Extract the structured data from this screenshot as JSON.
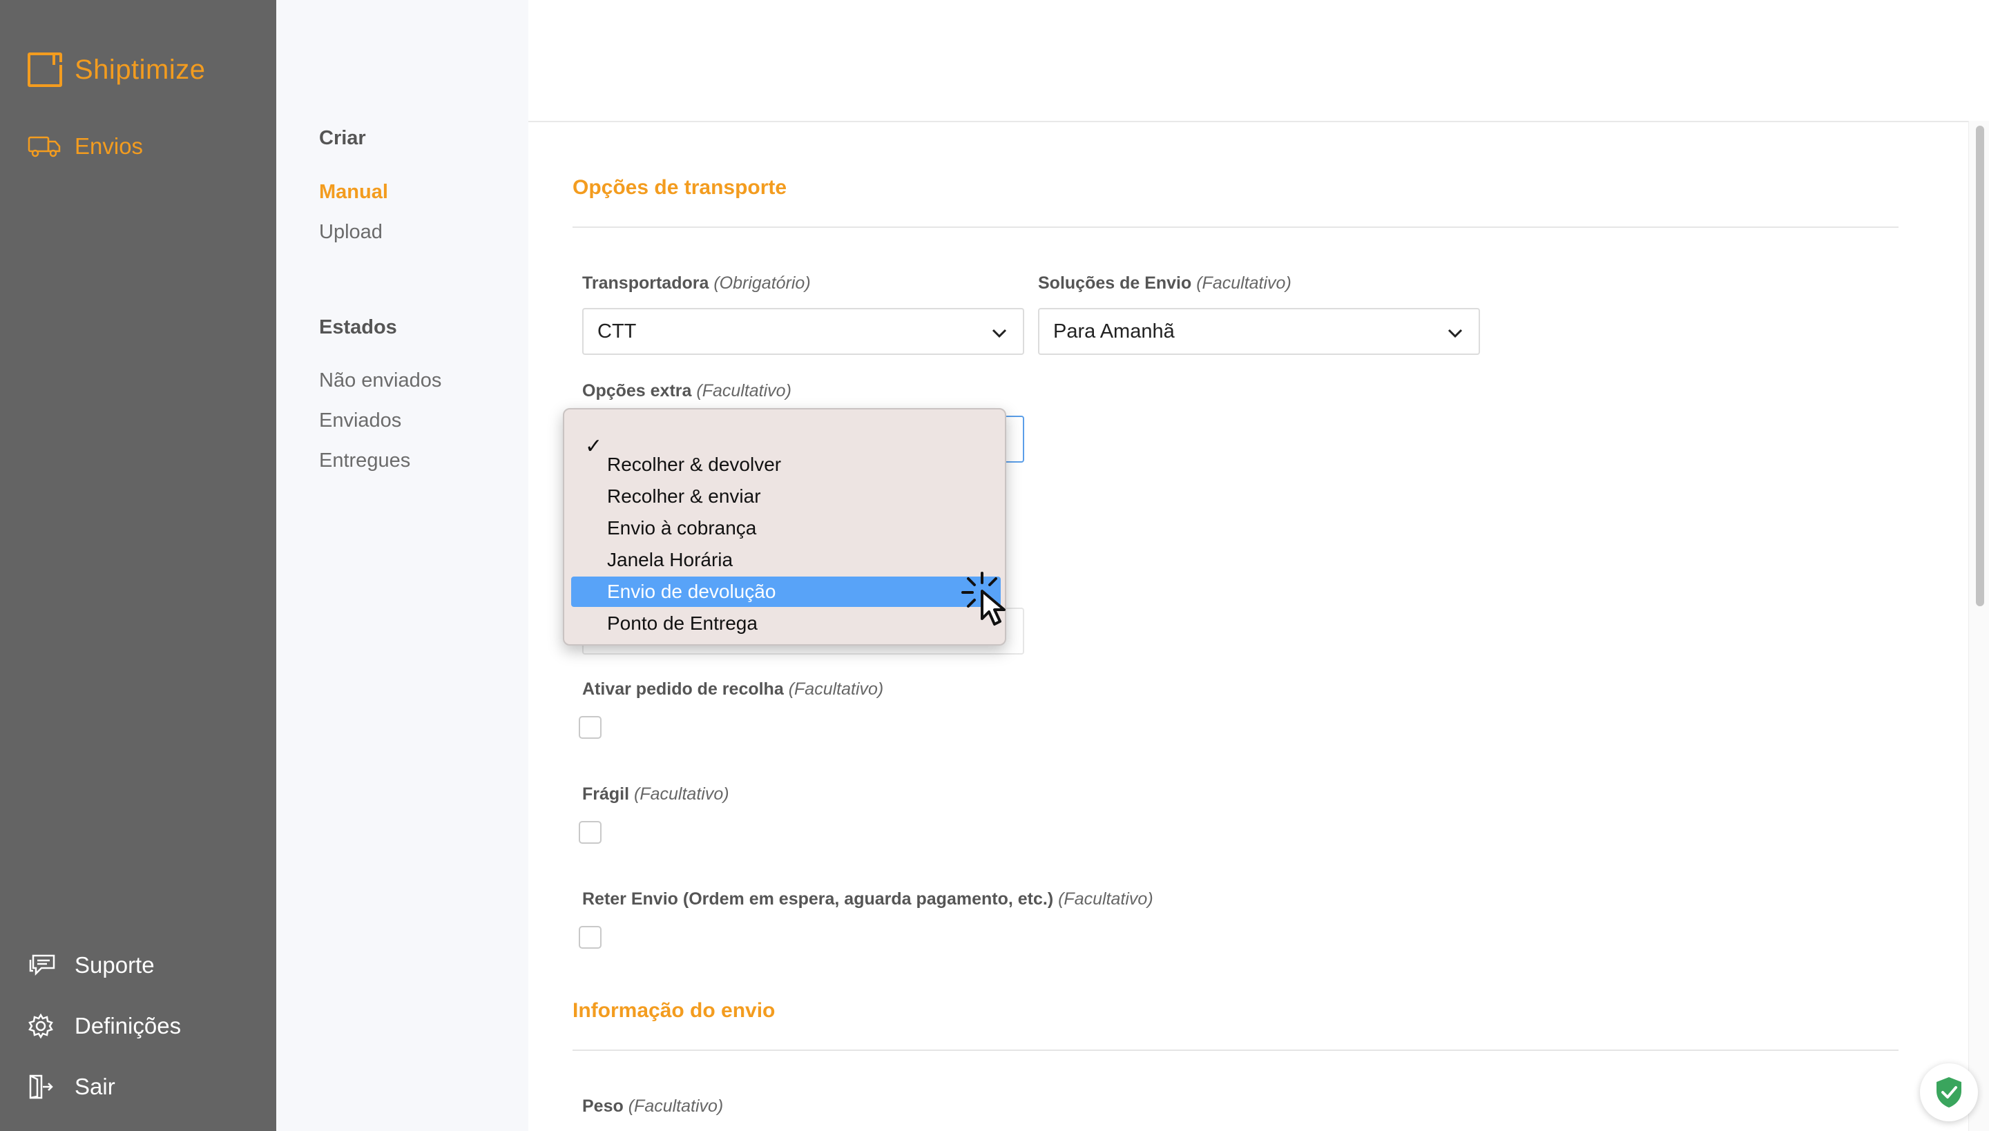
{
  "brand": {
    "name": "Shiptimize",
    "color": "#f39c1f"
  },
  "sidebar": {
    "items": [
      {
        "label": "Envios",
        "icon": "truck-icon",
        "active": true
      },
      {
        "label": "Suporte",
        "icon": "chat-icon"
      },
      {
        "label": "Definições",
        "icon": "gear-icon"
      },
      {
        "label": "Sair",
        "icon": "logout-icon"
      }
    ]
  },
  "subnav": {
    "create_title": "Criar",
    "create_items": [
      {
        "label": "Manual",
        "active": true
      },
      {
        "label": "Upload"
      }
    ],
    "status_title": "Estados",
    "status_items": [
      {
        "label": "Não enviados"
      },
      {
        "label": "Enviados"
      },
      {
        "label": "Entregues"
      }
    ]
  },
  "form": {
    "transport_section": "Opções de transporte",
    "carrier": {
      "label": "Transportadora",
      "hint": "(Obrigatório)",
      "value": "CTT"
    },
    "shipping_solutions": {
      "label": "Soluções de Envio",
      "hint": "(Facultativo)",
      "value": "Para Amanhã"
    },
    "extra_options": {
      "label": "Opções extra",
      "hint": "(Facultativo)",
      "checkmark": "✓",
      "options": [
        "Recolher & devolver",
        "Recolher & enviar",
        "Envio à cobrança",
        "Janela Horária",
        "Envio de devolução",
        "Ponto de Entrega"
      ],
      "highlighted": "Envio de devolução"
    },
    "pickup_request": {
      "label": "Ativar pedido de recolha",
      "hint": "(Facultativo)",
      "checked": false
    },
    "fragile": {
      "label": "Frágil",
      "hint": "(Facultativo)",
      "checked": false
    },
    "hold": {
      "label": "Reter Envio (Ordem em espera, aguarda pagamento, etc.)",
      "hint": "(Facultativo)",
      "checked": false
    },
    "shipment_section": "Informação do envio",
    "weight": {
      "label": "Peso",
      "hint": "(Facultativo)"
    }
  }
}
